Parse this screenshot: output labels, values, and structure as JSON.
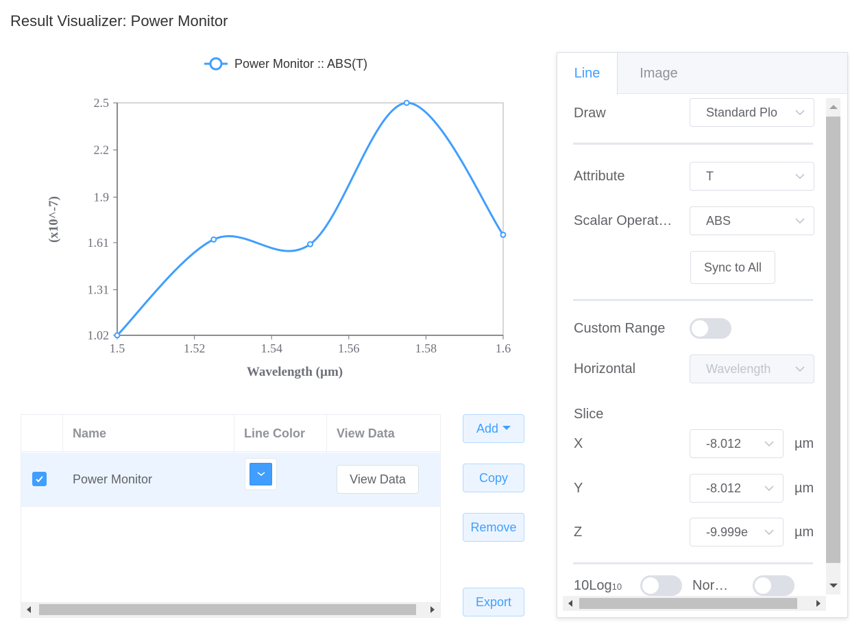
{
  "page_title": "Result Visualizer: Power Monitor",
  "chart": {
    "legend": "Power Monitor :: ABS(T)"
  },
  "chart_data": {
    "type": "line",
    "title": "",
    "xlabel": "Wavelength (µm)",
    "ylabel": "(x10^-7)",
    "xlim": [
      1.5,
      1.6
    ],
    "ylim": [
      1.02,
      2.5
    ],
    "x_ticks": [
      "1.5",
      "1.52",
      "1.54",
      "1.56",
      "1.58",
      "1.6"
    ],
    "y_ticks": [
      "1.02",
      "1.31",
      "1.61",
      "1.9",
      "2.2",
      "2.5"
    ],
    "grid": false,
    "legend_position": "top",
    "series": [
      {
        "name": "Power Monitor :: ABS(T)",
        "color": "#409eff",
        "x": [
          1.5,
          1.525,
          1.55,
          1.575,
          1.6
        ],
        "y": [
          1.02,
          1.63,
          1.6,
          2.5,
          1.66
        ]
      }
    ]
  },
  "table": {
    "headers": [
      "Name",
      "Line Color",
      "View Data"
    ],
    "rows": [
      {
        "checked": true,
        "name": "Power Monitor",
        "line_color": "#409eff",
        "view_label": "View Data"
      }
    ]
  },
  "actions": {
    "add": "Add",
    "copy": "Copy",
    "remove": "Remove",
    "export": "Export"
  },
  "panel": {
    "tabs": [
      "Line",
      "Image"
    ],
    "active_tab": "Line",
    "draw_label": "Draw",
    "draw_value": "Standard Plo",
    "attribute_label": "Attribute",
    "attribute_value": "T",
    "scalar_label": "Scalar Operat…",
    "scalar_value": "ABS",
    "sync_label": "Sync to All",
    "custom_range_label": "Custom Range",
    "custom_range_on": false,
    "horizontal_label": "Horizontal",
    "horizontal_value": "Wavelength",
    "slice_label": "Slice",
    "x_label": "X",
    "x_value": "-8.012",
    "y_label": "Y",
    "y_value": "-8.012",
    "z_label": "Z",
    "z_value": "-9.999e",
    "unit": "µm",
    "log_label": "10Log",
    "log_sub": "10",
    "log_on": false,
    "norm_label": "Nor…",
    "norm_on": false
  }
}
